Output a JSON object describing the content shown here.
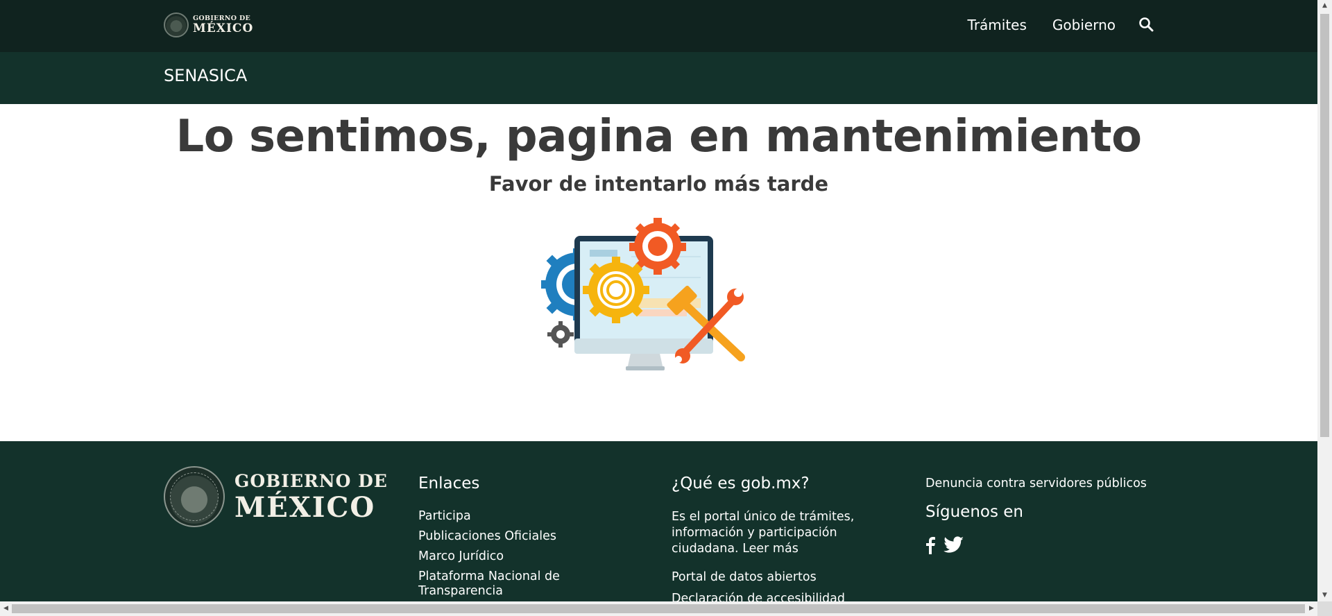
{
  "header": {
    "logo_line1": "GOBIERNO DE",
    "logo_line2": "MÉXICO",
    "nav": [
      {
        "label": "Trámites"
      },
      {
        "label": "Gobierno"
      }
    ],
    "search_icon": "search-icon"
  },
  "subheader": {
    "title": "SENASICA"
  },
  "main": {
    "title": "Lo sentimos, pagina en mantenimiento",
    "subtitle": "Favor de intentarlo más tarde",
    "illustration_icon": "maintenance-illustration"
  },
  "footer": {
    "logo_line1": "GOBIERNO DE",
    "logo_line2": "MÉXICO",
    "enlaces": {
      "heading": "Enlaces",
      "items": [
        {
          "label": "Participa"
        },
        {
          "label": "Publicaciones Oficiales"
        },
        {
          "label": "Marco Jurídico"
        },
        {
          "label": "Plataforma Nacional de Transparencia"
        }
      ]
    },
    "que_es": {
      "heading": "¿Qué es gob.mx?",
      "description": "Es el portal único de trámites, información y participación ciudadana.",
      "read_more": "Leer más",
      "links": [
        {
          "label": "Portal de datos abiertos"
        },
        {
          "label": "Declaración de accesibilidad"
        }
      ]
    },
    "social": {
      "denuncia": "Denuncia contra servidores públicos",
      "heading": "Síguenos en",
      "icons": [
        "facebook-icon",
        "twitter-icon"
      ]
    }
  },
  "colors": {
    "topbar": "#10231f",
    "subbar": "#13322b",
    "footer": "#13322b",
    "title_text": "#3a3a3a"
  }
}
